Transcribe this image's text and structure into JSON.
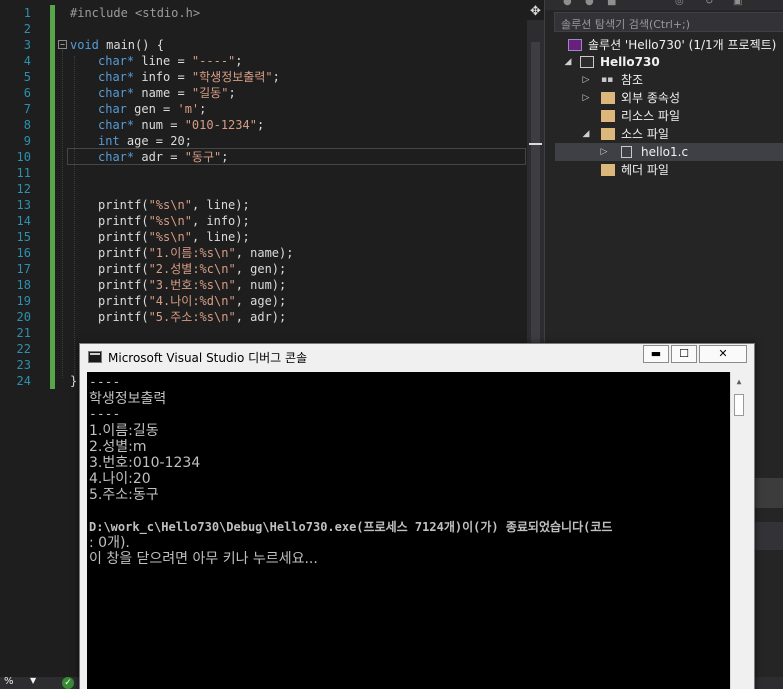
{
  "editor": {
    "line_numbers": [
      "1",
      "2",
      "3",
      "4",
      "5",
      "6",
      "7",
      "8",
      "9",
      "10",
      "11",
      "12",
      "13",
      "14",
      "15",
      "16",
      "17",
      "18",
      "19",
      "20",
      "21",
      "22",
      "23",
      "24"
    ],
    "code": {
      "include": "#include <stdio.h>",
      "main_kw": "void",
      "main_rest": " main() {",
      "l4_type": "char*",
      "l4_rest": " line = ",
      "l4_str": "\"----\"",
      "l4_end": ";",
      "l5_type": "char*",
      "l5_rest": " info = ",
      "l5_str": "\"학생정보출력\"",
      "l5_end": ";",
      "l6_type": "char*",
      "l6_rest": " name = ",
      "l6_str": "\"길동\"",
      "l6_end": ";",
      "l7_type": "char",
      "l7_rest": " gen = ",
      "l7_str": "'m'",
      "l7_end": ";",
      "l8_type": "char*",
      "l8_rest": " num = ",
      "l8_str": "\"010-1234\"",
      "l8_end": ";",
      "l9_type": "int",
      "l9_rest": " age = 20;",
      "l10_type": "char*",
      "l10_rest": " adr = ",
      "l10_str": "\"동구\"",
      "l10_end": ";",
      "p13_a": "printf(",
      "p13_s": "\"%s\\n\"",
      "p13_b": ", line);",
      "p14_a": "printf(",
      "p14_s": "\"%s\\n\"",
      "p14_b": ", info);",
      "p15_a": "printf(",
      "p15_s": "\"%s\\n\"",
      "p15_b": ", line);",
      "p16_a": "printf(",
      "p16_s": "\"1.이름:%s\\n\"",
      "p16_b": ", name);",
      "p17_a": "printf(",
      "p17_s": "\"2.성별:%c\\n\"",
      "p17_b": ", gen);",
      "p18_a": "printf(",
      "p18_s": "\"3.번호:%s\\n\"",
      "p18_b": ", num);",
      "p19_a": "printf(",
      "p19_s": "\"4.나이:%d\\n\"",
      "p19_b": ", age);",
      "p20_a": "printf(",
      "p20_s": "\"5.주소:%s\\n\"",
      "p20_b": ", adr);",
      "close": "}"
    }
  },
  "status": {
    "zoom": "%",
    "ok_glyph": "✓"
  },
  "explorer": {
    "search_placeholder": "솔루션 탐색기 검색(Ctrl+;)",
    "solution": "솔루션 'Hello730' (1/1개 프로젝트)",
    "project": "Hello730",
    "references": "참조",
    "external_deps": "외부 종속성",
    "resource_files": "리소스 파일",
    "source_files": "소스 파일",
    "source_file_item": "hello1.c",
    "header_files": "헤더 파일"
  },
  "console": {
    "title": "Microsoft Visual Studio 디버그 콘솔",
    "min_glyph": "▬",
    "max_glyph": "☐",
    "close_glyph": "✕",
    "lines": [
      "----",
      "학생정보출력",
      "----",
      "1.이름:길동",
      "2.성별:m",
      "3.번호:010-1234",
      "4.나이:20",
      "5.주소:동구",
      "",
      "D:\\work_c\\Hello730\\Debug\\Hello730.exe(프로세스 7124개)이(가) 종료되었습니다(코드",
      ": 0개).",
      "이 창을 닫으려면 아무 키나 누르세요..."
    ]
  },
  "colors": {
    "editor_bg": "#1e1e1e",
    "keyword": "#569cd6",
    "string": "#d69d85",
    "line_number": "#2b91af",
    "change_bar": "#57a64a",
    "explorer_bg": "#252526",
    "console_bg": "#000000",
    "console_fg": "#c0c0c0"
  }
}
